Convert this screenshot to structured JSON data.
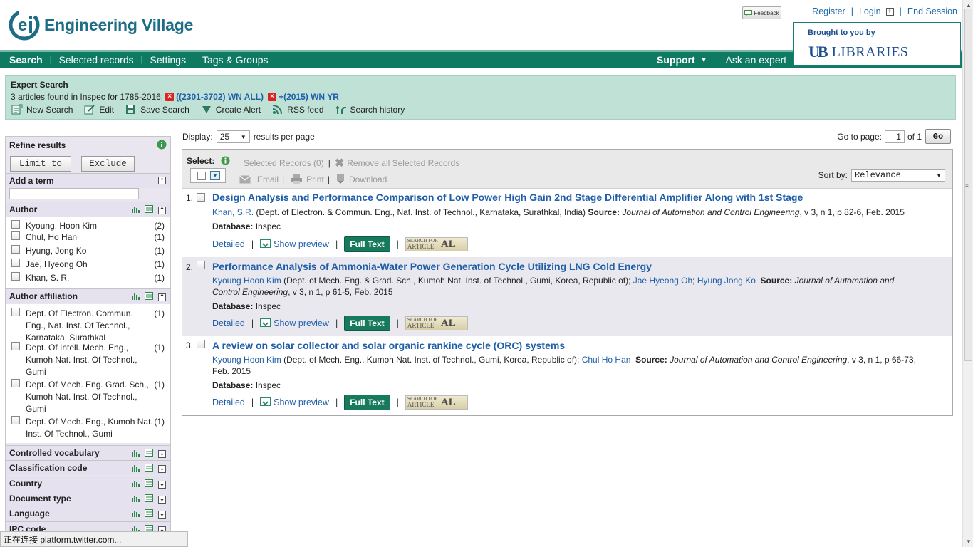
{
  "header": {
    "logo_text": "Engineering Village",
    "feedback_label": "Feedback",
    "links": [
      "Register",
      "Login",
      "End Session"
    ],
    "brought_by": "Brought to you by",
    "library_mark": "UB",
    "library_name": "Libraries"
  },
  "nav": {
    "items": [
      "Search",
      "Selected records",
      "Settings",
      "Tags & Groups"
    ],
    "right": [
      "Support",
      "Ask an expert"
    ]
  },
  "expert": {
    "title": "Expert Search",
    "summary": "3 articles found in Inspec for 1785-2016:",
    "query1": "((2301-3702) WN ALL)",
    "query2": "+(2015) WN YR",
    "tools": [
      "New Search",
      "Edit",
      "Save Search",
      "Create Alert",
      "RSS feed",
      "Search history"
    ]
  },
  "sidebar": {
    "title": "Refine results",
    "limit_label": "Limit to",
    "exclude_label": "Exclude",
    "add_term": "Add a term",
    "author_title": "Author",
    "authors": [
      {
        "name": "Kyoung, Hoon Kim",
        "count": "(2)"
      },
      {
        "name": "Chul, Ho Han",
        "count": "(1)"
      },
      {
        "name": "Hyung, Jong Ko",
        "count": "(1)"
      },
      {
        "name": "Jae, Hyeong Oh",
        "count": "(1)"
      },
      {
        "name": "Khan, S. R.",
        "count": "(1)"
      }
    ],
    "affil_title": "Author affiliation",
    "affiliations": [
      {
        "lines": [
          "Dept. Of Electron. Commun.",
          "Eng., Nat. Inst. Of Technol.,",
          "Karnataka, Surathkal"
        ],
        "count": "(1)"
      },
      {
        "lines": [
          "Dept. Of Intell. Mech. Eng.,",
          "Kumoh Nat. Inst. Of Technol.,",
          "Gumi"
        ],
        "count": "(1)"
      },
      {
        "lines": [
          "Dept. Of Mech. Eng. Grad. Sch.,",
          "Kumoh Nat. Inst. Of Technol.,",
          "Gumi"
        ],
        "count": "(1)"
      },
      {
        "lines": [
          "Dept. Of Mech. Eng., Kumoh Nat.",
          "Inst. Of Technol., Gumi"
        ],
        "count": "(1)"
      }
    ],
    "collapsed": [
      "Controlled vocabulary",
      "Classification code",
      "Country",
      "Document type",
      "Language",
      "IPC code"
    ]
  },
  "results_header": {
    "display_label": "Display:",
    "display_value": "25",
    "per_page": "results per page",
    "goto_label": "Go to page:",
    "page_value": "1",
    "of_label": "of 1",
    "go_label": "Go",
    "select_label": "Select:",
    "selected_records": "Selected Records (0)",
    "remove_all": "Remove all Selected Records",
    "email": "Email",
    "print": "Print",
    "download": "Download",
    "sortby_label": "Sort by:",
    "sortby_value": "Relevance"
  },
  "records": [
    {
      "num": "1.",
      "title": "Design Analysis and Performance Comparison of Low Power High Gain 2nd Stage Differential Amplifier Along with 1st Stage",
      "author": "Khan, S.R.",
      "affil": " (Dept. of Electron. & Commun. Eng., Nat. Inst. of Technol., Karnataka, Surathkal, India)  ",
      "source_label": "Source:",
      "source_journal": "Journal of Automation and Control Engineering",
      "source_rest": ", v 3, n 1, p 82-6, Feb. 2015",
      "db_label": "Database:",
      "db_value": "Inspec"
    },
    {
      "num": "2.",
      "title": "Performance Analysis of Ammonia-Water Power Generation Cycle Utilizing LNG Cold Energy",
      "author": "Kyoung Hoon Kim",
      "affil": " (Dept. of Mech. Eng. & Grad. Sch., Kumoh Nat. Inst. of Technol., Gumi, Korea, Republic of); ",
      "author2": "Jae Hyeong Oh",
      "author3": "Hyung Jong Ko",
      "source_label": "Source:",
      "source_journal": "Journal of Automation and Control Engineering",
      "source_rest": ", v 3, n 1, p 61-5, Feb. 2015",
      "db_label": "Database:",
      "db_value": "Inspec"
    },
    {
      "num": "3.",
      "title": "A review on solar collector and solar organic rankine cycle (ORC) systems",
      "author": "Kyoung Hoon Kim",
      "affil": " (Dept. of Mech. Eng., Kumoh Nat. Inst. of Technol., Gumi, Korea, Republic of); ",
      "author2": "Chul Ho Han",
      "source_label": "Source:",
      "source_journal": "Journal of Automation and Control Engineering",
      "source_rest": ", v 3, n 1, p 66-73, Feb. 2015",
      "db_label": "Database:",
      "db_value": "Inspec"
    }
  ],
  "record_links": {
    "detailed": "Detailed",
    "preview": "Show preview",
    "fulltext": "Full Text",
    "sfa_top": "SEARCH FOR",
    "sfa_bottom": "ARTICLE",
    "sfa_mark": "AL"
  },
  "status_bar": "正在连接 platform.twitter.com...",
  "colors": {
    "nav": "#0d7a61",
    "expert_bg": "#bfe1d6",
    "link": "#1f5ea8",
    "fulltext": "#187a5c"
  }
}
